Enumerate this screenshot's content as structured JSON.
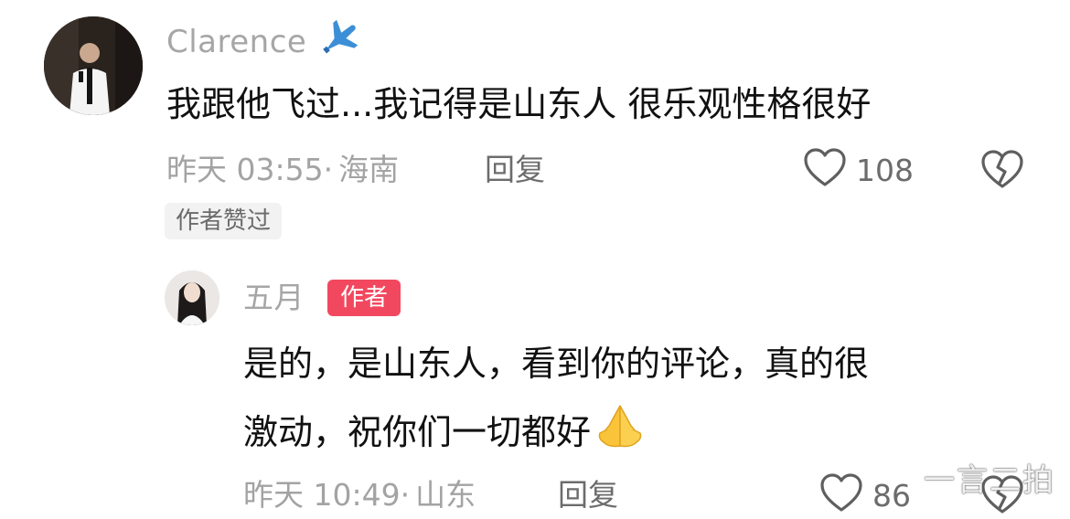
{
  "comment": {
    "username": "Clarence",
    "username_emoji_icon": "airplane-icon",
    "text": "我跟他飞过...我记得是山东人 很乐观性格很好",
    "time": "昨天 03:55",
    "separator": "·",
    "location": "海南",
    "reply_label": "回复",
    "like_count": "108",
    "liked_by_author_tag": "作者赞过"
  },
  "reply": {
    "username": "五月",
    "author_badge": "作者",
    "text_line1": "是的，是山东人，看到你的评论，真的很",
    "text_line2": "激动，祝你们一切都好",
    "emoji_icon": "praying-hands-icon",
    "time": "昨天 10:49",
    "separator": "·",
    "location": "山东",
    "reply_label": "回复",
    "like_count": "86"
  },
  "watermark": "一言二拍",
  "colors": {
    "username_gray": "#a6a6a6",
    "comment_text": "#111111",
    "meta_gray": "#a3a3a3",
    "author_badge_bg": "#f2485f"
  }
}
